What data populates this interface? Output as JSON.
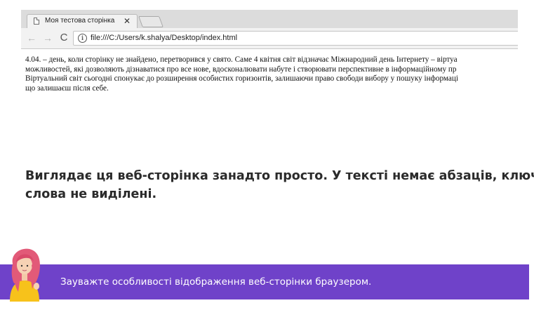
{
  "browser": {
    "tab": {
      "title": "Моя тестова сторінка",
      "close_glyph": "✕",
      "icon": "page-icon"
    },
    "toolbar": {
      "back_glyph": "←",
      "forward_glyph": "→",
      "reload_glyph": "C",
      "info_glyph": "i",
      "url": "file:///C:/Users/k.shalya/Desktop/index.html"
    },
    "page_text_lines": [
      "4.04. – день, коли сторінку не знайдено, перетворився у свято. Саме 4 квітня світ відзначає Міжнародний день Інтернету – віртуа",
      "можливостей, які дозволяють дізнаватися про все нове, вдосконалювати набуте і створювати перспективне в інформаційному пр",
      "Віртуальний світ сьогодні спонукає до розширення особистих горизонтів, залишаючи право свободи вибору у пошуку інформаці",
      "що залишаєш після себе."
    ]
  },
  "slide": {
    "comment_lines": [
      "Виглядає ця веб-сторінка занадто просто. У тексті немає абзаців, ключові",
      "слова не виділені."
    ],
    "banner_text": "Зауважте особливості відображення веб-сторінки браузером.",
    "banner_color": "#6f42c9"
  }
}
